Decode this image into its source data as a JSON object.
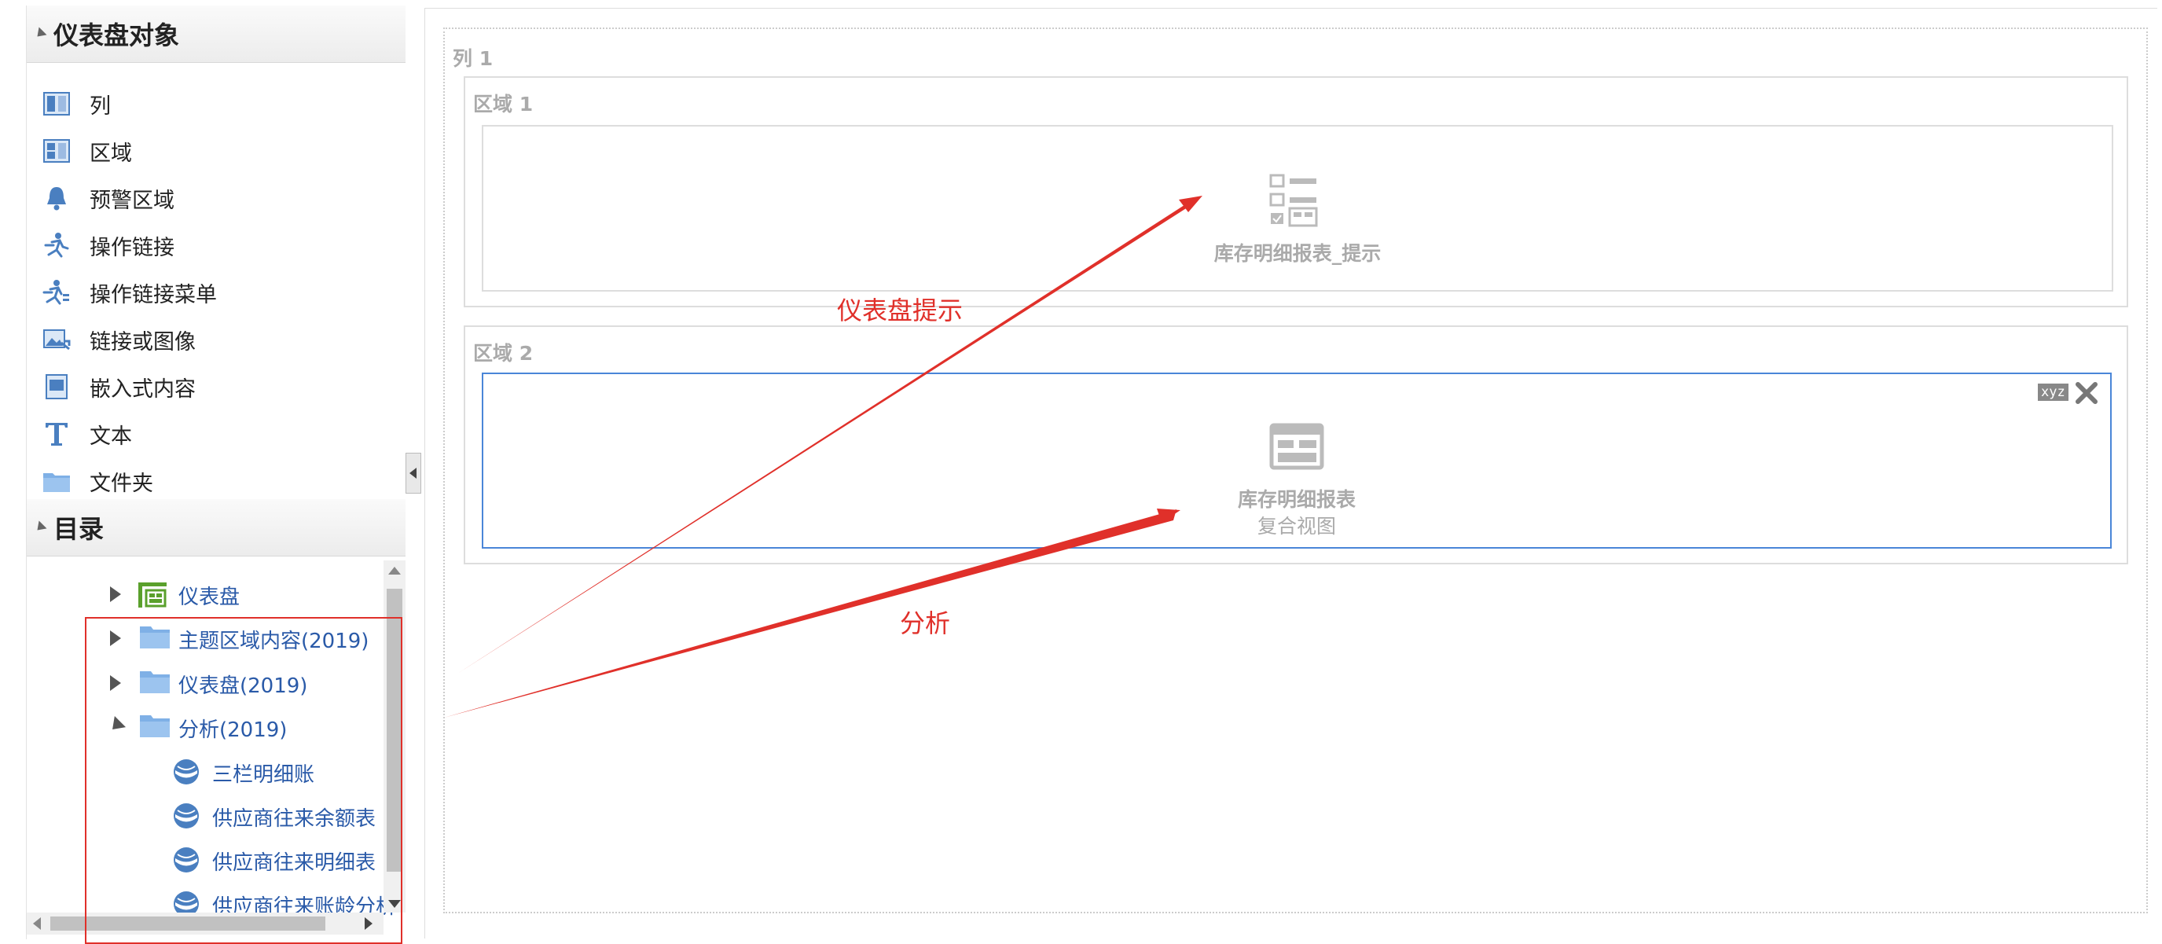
{
  "objects_panel": {
    "title": "仪表盘对象",
    "items": [
      {
        "label": "列",
        "icon": "column-icon"
      },
      {
        "label": "区域",
        "icon": "section-icon"
      },
      {
        "label": "预警区域",
        "icon": "bell-icon"
      },
      {
        "label": "操作链接",
        "icon": "action-link-icon"
      },
      {
        "label": "操作链接菜单",
        "icon": "action-link-menu-icon"
      },
      {
        "label": "链接或图像",
        "icon": "link-image-icon"
      },
      {
        "label": "嵌入式内容",
        "icon": "embedded-content-icon"
      },
      {
        "label": "文本",
        "icon": "text-icon"
      },
      {
        "label": "文件夹",
        "icon": "folder-icon"
      }
    ]
  },
  "catalog": {
    "title": "目录",
    "items": [
      {
        "label": "仪表盘",
        "icon": "dashboard-icon",
        "expand": "collapsed"
      },
      {
        "label": "主题区域内容(2019)",
        "icon": "folder-icon",
        "expand": "collapsed"
      },
      {
        "label": "仪表盘(2019)",
        "icon": "folder-icon",
        "expand": "collapsed"
      },
      {
        "label": "分析(2019)",
        "icon": "folder-icon",
        "expand": "expanded"
      },
      {
        "label": "三栏明细账",
        "icon": "analysis-icon"
      },
      {
        "label": "供应商往来余额表",
        "icon": "analysis-icon"
      },
      {
        "label": "供应商往来明细表",
        "icon": "analysis-icon"
      },
      {
        "label": "供应商往来账龄分析",
        "icon": "analysis-icon"
      }
    ]
  },
  "canvas": {
    "column_label": "列 1",
    "section1": {
      "label": "区域 1",
      "view_title": "库存明细报表_提示",
      "view_icon": "prompt-icon"
    },
    "section2": {
      "label": "区域 2",
      "view_title": "库存明细报表",
      "view_subtitle": "复合视图",
      "view_icon": "compound-view-icon",
      "badge": "xyz",
      "close_icon": "close-icon"
    }
  },
  "annotations": {
    "label_prompt": "仪表盘提示",
    "label_analysis": "分析",
    "color": "#e0302a"
  }
}
